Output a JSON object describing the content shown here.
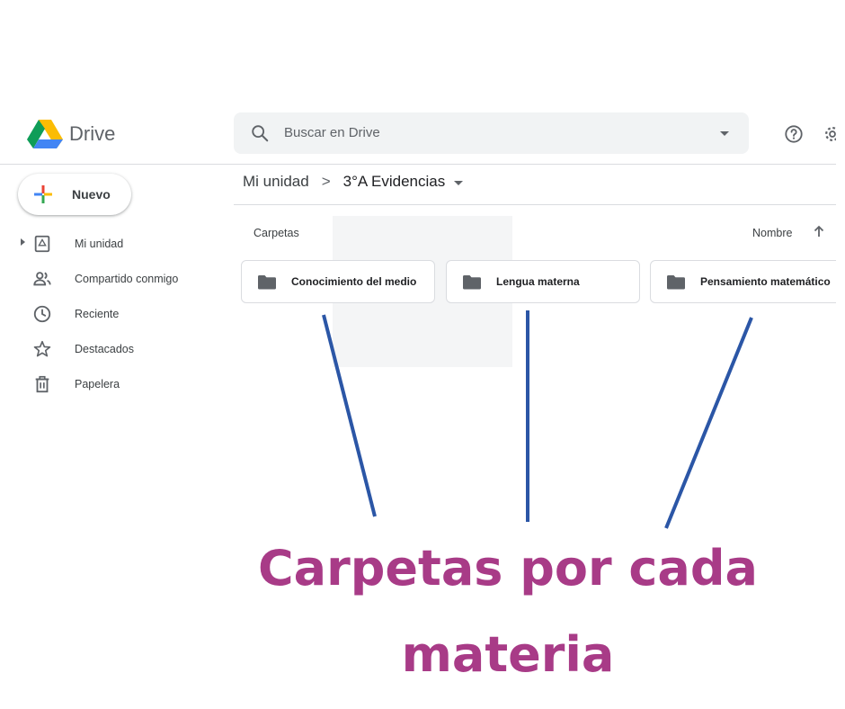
{
  "app": {
    "name": "Drive"
  },
  "search": {
    "placeholder": "Buscar en Drive"
  },
  "header_icons": [
    "help-icon",
    "gear-icon"
  ],
  "new_button": {
    "label": "Nuevo"
  },
  "sidebar": {
    "items": [
      {
        "label": "Mi unidad",
        "icon": "my-drive-icon",
        "expandable": true
      },
      {
        "label": "Compartido conmigo",
        "icon": "shared-people-icon"
      },
      {
        "label": "Reciente",
        "icon": "clock-icon"
      },
      {
        "label": "Destacados",
        "icon": "star-icon"
      },
      {
        "label": "Papelera",
        "icon": "trash-icon"
      }
    ]
  },
  "breadcrumb": {
    "root": "Mi unidad",
    "separator": ">",
    "current": "3°A Evidencias"
  },
  "folders_section": {
    "label": "Carpetas",
    "sort_label": "Nombre",
    "sort_direction": "ascending",
    "items": [
      {
        "name": "Conocimiento del medio"
      },
      {
        "name": "Lengua materna"
      },
      {
        "name": "Pensamiento matemático"
      }
    ]
  },
  "caption": {
    "line1": "Carpetas por cada",
    "line2": "materia"
  },
  "colors": {
    "caption": "#a83b87",
    "arrows": "#2b56a6",
    "folder_icon": "#5f6368"
  }
}
